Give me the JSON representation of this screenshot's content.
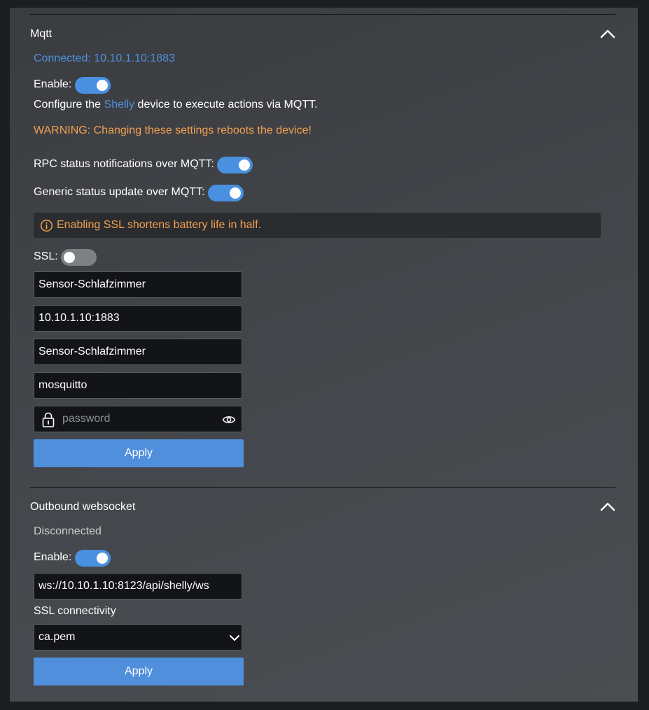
{
  "mqtt": {
    "title": "Mqtt",
    "status": "Connected: 10.10.1.10:1883",
    "enable_label": "Enable:",
    "enable_on": true,
    "desc_before": "Configure the ",
    "desc_link": "Shelly",
    "desc_after": " device to execute actions via MQTT.",
    "warning": "WARNING: Changing these settings reboots the device!",
    "rpc_label": "RPC status notifications over MQTT:",
    "rpc_on": true,
    "generic_label": "Generic status update over MQTT:",
    "generic_on": true,
    "ssl_notice": "Enabling SSL shortens battery life in half.",
    "ssl_label": "SSL:",
    "ssl_on": false,
    "client_id": "Sensor-Schlafzimmer",
    "server": "10.10.1.10:1883",
    "topic_prefix": "Sensor-Schlafzimmer",
    "user": "mosquitto",
    "password_placeholder": "password",
    "apply_label": "Apply"
  },
  "ws": {
    "title": "Outbound websocket",
    "status": "Disconnected",
    "enable_label": "Enable:",
    "enable_on": true,
    "server": "ws://10.10.1.10:8123/api/shelly/ws",
    "ssl_label": "SSL connectivity",
    "ssl_selected": "ca.pem",
    "apply_label": "Apply"
  },
  "colors": {
    "accent": "#4f8fdc",
    "warning": "#f0a050",
    "toggle_on": "#4a90e0",
    "toggle_off": "#7d8084"
  },
  "icons": [
    "chevron-up-icon",
    "info-icon",
    "lock-icon",
    "eye-icon",
    "chevron-down-icon"
  ]
}
